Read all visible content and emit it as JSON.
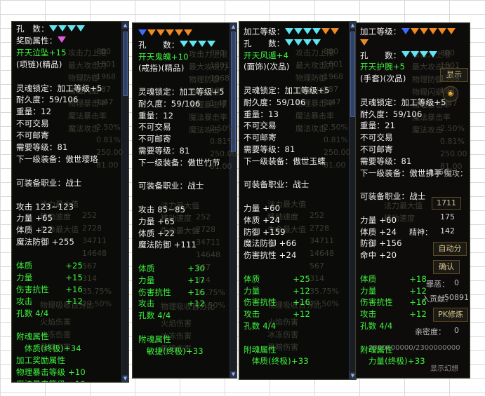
{
  "panels": [
    {
      "lines": [
        {
          "t": "孔　数：",
          "c": "w",
          "gems": [
            "c",
            "c",
            "c",
            "c"
          ]
        },
        {
          "t": "奖励属性：",
          "c": "w",
          "gems": [
            "p"
          ]
        },
        {
          "t": "开天泣坠+15",
          "c": "g"
        },
        {
          "t": "(项链)(精品)",
          "c": "w"
        },
        {
          "t": "",
          "c": "w"
        },
        {
          "t": "灵魂锁定：加工等级+5",
          "c": "w"
        },
        {
          "t": "耐久度：59/106",
          "c": "w"
        },
        {
          "t": "重量：12",
          "c": "w"
        },
        {
          "t": "不可交易",
          "c": "w"
        },
        {
          "t": "不可邮寄",
          "c": "w"
        },
        {
          "t": "需要等级：81",
          "c": "w"
        },
        {
          "t": "下一级装备：傲世璎珞",
          "c": "w"
        },
        {
          "t": "",
          "c": "w"
        },
        {
          "t": "可装备职业：战士",
          "c": "w"
        },
        {
          "t": "",
          "c": "w"
        },
        {
          "t": "攻击 123~123",
          "c": "w"
        },
        {
          "t": "力量 +65",
          "c": "w"
        },
        {
          "t": "体质 +22",
          "c": "w"
        },
        {
          "t": "魔法防御 +255",
          "c": "w"
        },
        {
          "t": "",
          "c": "w"
        },
        {
          "t": "体质　　　　+25",
          "c": "g"
        },
        {
          "t": "力量　　　　+15",
          "c": "g"
        },
        {
          "t": "伤害抗性　　+16",
          "c": "g"
        },
        {
          "t": "攻击　　　　+12",
          "c": "g"
        },
        {
          "t": "孔数 4/4",
          "c": "g"
        },
        {
          "t": "",
          "c": "w"
        },
        {
          "t": "附魂属性",
          "c": "g"
        },
        {
          "t": "　体质(终极)+34",
          "c": "g"
        },
        {
          "t": "加工奖励属性",
          "c": "g"
        },
        {
          "t": "物理暴击等级 +10",
          "c": "g"
        },
        {
          "t": "魔法暴击等级 +10",
          "c": "g"
        }
      ]
    },
    {
      "lines": [
        {
          "t": "",
          "c": "w",
          "gems": [
            "b",
            "o",
            "o",
            "o",
            "o",
            "o"
          ]
        },
        {
          "t": "孔　　数：",
          "c": "w",
          "gems": [
            "c",
            "c",
            "c",
            "c"
          ]
        },
        {
          "t": "开天鬼魄+10",
          "c": "g"
        },
        {
          "t": "(戒指)(精品)",
          "c": "w"
        },
        {
          "t": "",
          "c": "w"
        },
        {
          "t": "灵魂锁定：加工等级+5",
          "c": "w"
        },
        {
          "t": "耐久度：59/106",
          "c": "w"
        },
        {
          "t": "重量：12",
          "c": "w"
        },
        {
          "t": "不可交易",
          "c": "w"
        },
        {
          "t": "不可邮寄",
          "c": "w"
        },
        {
          "t": "需要等级：81",
          "c": "w"
        },
        {
          "t": "下一级装备：傲世竹节",
          "c": "w"
        },
        {
          "t": "",
          "c": "w"
        },
        {
          "t": "可装备职业：战士",
          "c": "w"
        },
        {
          "t": "",
          "c": "w"
        },
        {
          "t": "攻击 85~85",
          "c": "w"
        },
        {
          "t": "力量 +65",
          "c": "w"
        },
        {
          "t": "体质 +22",
          "c": "w"
        },
        {
          "t": "魔法防御 +111",
          "c": "w"
        },
        {
          "t": "",
          "c": "w"
        },
        {
          "t": "体质　　　　+30",
          "c": "g"
        },
        {
          "t": "力量　　　　+17",
          "c": "g"
        },
        {
          "t": "伤害抗性　　+16",
          "c": "g"
        },
        {
          "t": "攻击　　　　+12",
          "c": "g"
        },
        {
          "t": "孔数 4/4",
          "c": "g"
        },
        {
          "t": "",
          "c": "w"
        },
        {
          "t": "附魂属性",
          "c": "g"
        },
        {
          "t": "　敏捷(终极)+33",
          "c": "g"
        }
      ]
    },
    {
      "lines": [
        {
          "t": "加工等级：",
          "c": "w",
          "gems": [
            "c",
            "c",
            "c",
            "c",
            "o",
            "o"
          ]
        },
        {
          "t": "孔　　数：",
          "c": "w",
          "gems": [
            "c",
            "c",
            "c",
            "c"
          ]
        },
        {
          "t": "开天风遁+4",
          "c": "g"
        },
        {
          "t": "(面饰)(次品)",
          "c": "w"
        },
        {
          "t": "",
          "c": "w"
        },
        {
          "t": "灵魂锁定：加工等级+5",
          "c": "w"
        },
        {
          "t": "耐久度：59/106",
          "c": "w"
        },
        {
          "t": "重量：13",
          "c": "w"
        },
        {
          "t": "不可交易",
          "c": "w"
        },
        {
          "t": "不可邮寄",
          "c": "w"
        },
        {
          "t": "需要等级：81",
          "c": "w"
        },
        {
          "t": "下一级装备：傲世玉蝶",
          "c": "w"
        },
        {
          "t": "",
          "c": "w"
        },
        {
          "t": "可装备职业：战士",
          "c": "w"
        },
        {
          "t": "",
          "c": "w"
        },
        {
          "t": "力量 +60",
          "c": "w"
        },
        {
          "t": "体质 +24",
          "c": "w"
        },
        {
          "t": "防御 +159",
          "c": "w"
        },
        {
          "t": "魔法防御 +66",
          "c": "w"
        },
        {
          "t": "伤害抗性 +24",
          "c": "w"
        },
        {
          "t": "",
          "c": "w"
        },
        {
          "t": "体质　　　　+25",
          "c": "g"
        },
        {
          "t": "力量　　　　+12",
          "c": "g"
        },
        {
          "t": "伤害抗性　　+16",
          "c": "g"
        },
        {
          "t": "攻击　　　　+12",
          "c": "g"
        },
        {
          "t": "孔数 4/4",
          "c": "g"
        },
        {
          "t": "",
          "c": "w"
        },
        {
          "t": "附魂属性",
          "c": "g"
        },
        {
          "t": "　体质(终极)+33",
          "c": "g"
        }
      ]
    },
    {
      "lines": [
        {
          "t": "加工等级：",
          "c": "w",
          "gems": [
            "b",
            "o",
            "o",
            "o",
            "o",
            "o"
          ]
        },
        {
          "t": "",
          "c": "w",
          "gems": [
            "o"
          ]
        },
        {
          "t": "孔　　数：",
          "c": "w",
          "gems": [
            "c",
            "c",
            "c",
            "c"
          ]
        },
        {
          "t": "开天护腕+5",
          "c": "g"
        },
        {
          "t": "(手套)(次品)",
          "c": "w"
        },
        {
          "t": "",
          "c": "w"
        },
        {
          "t": "灵魂锁定：加工等级+5",
          "c": "w"
        },
        {
          "t": "耐久度：59/106",
          "c": "w"
        },
        {
          "t": "重量：21",
          "c": "w"
        },
        {
          "t": "不可交易",
          "c": "w"
        },
        {
          "t": "不可邮寄",
          "c": "w"
        },
        {
          "t": "需要等级：81",
          "c": "w"
        },
        {
          "t": "下一级装备：傲世拂手",
          "c": "w"
        },
        {
          "t": "",
          "c": "w"
        },
        {
          "t": "可装备职业：战士",
          "c": "w"
        },
        {
          "t": "",
          "c": "w"
        },
        {
          "t": "力量 +60",
          "c": "w"
        },
        {
          "t": "体质 +24",
          "c": "w"
        },
        {
          "t": "防御 +156",
          "c": "w"
        },
        {
          "t": "命中 +20",
          "c": "w"
        },
        {
          "t": "",
          "c": "w"
        },
        {
          "t": "体质　　　　+18",
          "c": "g"
        },
        {
          "t": "力量　　　　+12",
          "c": "g"
        },
        {
          "t": "伤害抗性　　+16",
          "c": "g"
        },
        {
          "t": "攻击　　　　+12",
          "c": "g"
        },
        {
          "t": "孔数 4/4",
          "c": "g"
        },
        {
          "t": "",
          "c": "w"
        },
        {
          "t": "附魂属性",
          "c": "g"
        },
        {
          "t": "　力量(终极)+33",
          "c": "g"
        }
      ]
    }
  ],
  "side_ui": {
    "display": "显示",
    "magic_attack": "魔攻：",
    "num_5166": "5166",
    "num_1711": "1711",
    "num_175": "175",
    "spirit": "精神：",
    "num_142": "142",
    "auto": "自动分",
    "confirm": "确认",
    "pk": "PK修炼",
    "evil": "罪恶：",
    "evil_val": "0",
    "contrib": "入贡献：",
    "contrib_val": "50891",
    "intimacy": "亲密度：",
    "intimacy_val": "0",
    "exp": "2300000000/2300000000",
    "show_illusion": "显示幻想"
  },
  "ghost_text": [
    "攻击力上限",
    "最大攻击力",
    "物理防御",
    "物理闪避",
    "物理暴击率",
    "魔法暴击率",
    "魔法攻击",
    "法力最大值",
    "移动速度",
    "生命最大值",
    "火焰伤害",
    "冰冻伤害",
    "物理吸收百分比",
    "黑暗伤害"
  ],
  "ghost_nums": [
    "880",
    "1801",
    "1968",
    "187",
    "1.47",
    "2.50%",
    "0.81%",
    "250.00",
    "81.00",
    "252",
    "2728",
    "34711",
    "14648",
    "567",
    "35.75%",
    "27.50%",
    "314"
  ]
}
